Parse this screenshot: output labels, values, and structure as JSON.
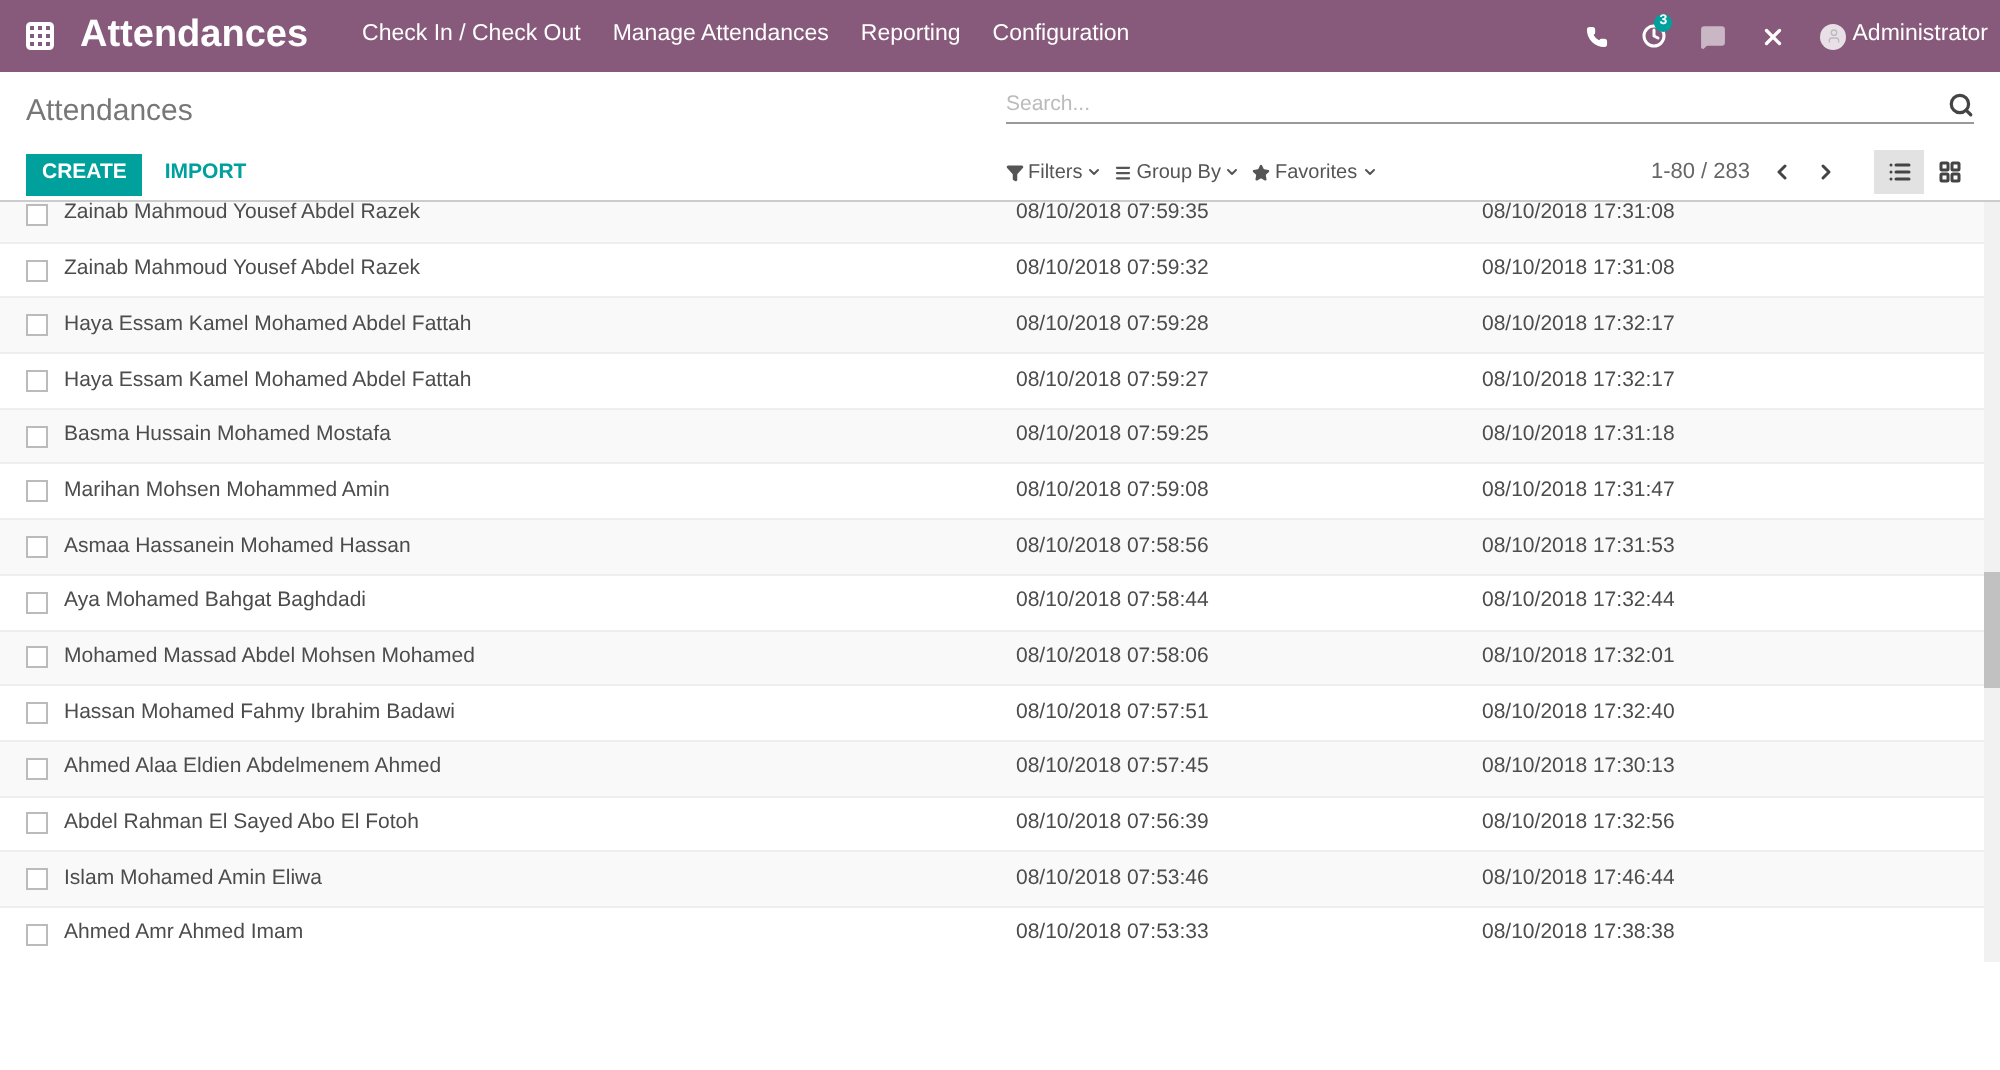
{
  "app_title": "Attendances",
  "menu": [
    "Check In / Check Out",
    "Manage Attendances",
    "Reporting",
    "Configuration"
  ],
  "systray": {
    "activity_count": "3",
    "user": "Administrator"
  },
  "breadcrumb": "Attendances",
  "search": {
    "placeholder": "Search..."
  },
  "buttons": {
    "create": "CREATE",
    "import": "IMPORT"
  },
  "search_options": [
    "Filters",
    "Group By",
    "Favorites"
  ],
  "pager": "1-80 / 283",
  "views": [
    {
      "kind": "list",
      "selected": true
    },
    {
      "kind": "kanban",
      "selected": false
    }
  ],
  "rows": [
    {
      "employee": "Zainab Mahmoud Yousef Abdel Razek",
      "check_in": "08/10/2018 07:59:35",
      "check_out": "08/10/2018 17:31:08",
      "checked": false
    },
    {
      "employee": "Zainab Mahmoud Yousef Abdel Razek",
      "check_in": "08/10/2018 07:59:32",
      "check_out": "08/10/2018 17:31:08",
      "checked": false
    },
    {
      "employee": "Haya Essam Kamel Mohamed Abdel Fattah",
      "check_in": "08/10/2018 07:59:28",
      "check_out": "08/10/2018 17:32:17",
      "checked": false
    },
    {
      "employee": "Haya Essam Kamel Mohamed Abdel Fattah",
      "check_in": "08/10/2018 07:59:27",
      "check_out": "08/10/2018 17:32:17",
      "checked": false
    },
    {
      "employee": "Basma Hussain Mohamed Mostafa",
      "check_in": "08/10/2018 07:59:25",
      "check_out": "08/10/2018 17:31:18",
      "checked": false
    },
    {
      "employee": "Marihan Mohsen Mohammed Amin",
      "check_in": "08/10/2018 07:59:08",
      "check_out": "08/10/2018 17:31:47",
      "checked": false
    },
    {
      "employee": "Asmaa Hassanein Mohamed Hassan",
      "check_in": "08/10/2018 07:58:56",
      "check_out": "08/10/2018 17:31:53",
      "checked": false
    },
    {
      "employee": "Aya Mohamed Bahgat Baghdadi",
      "check_in": "08/10/2018 07:58:44",
      "check_out": "08/10/2018 17:32:44",
      "checked": false
    },
    {
      "employee": "Mohamed Massad Abdel Mohsen Mohamed",
      "check_in": "08/10/2018 07:58:06",
      "check_out": "08/10/2018 17:32:01",
      "checked": false
    },
    {
      "employee": "Hassan Mohamed Fahmy Ibrahim Badawi",
      "check_in": "08/10/2018 07:57:51",
      "check_out": "08/10/2018 17:32:40",
      "checked": false
    },
    {
      "employee": "Ahmed Alaa Eldien Abdelmenem Ahmed",
      "check_in": "08/10/2018 07:57:45",
      "check_out": "08/10/2018 17:30:13",
      "checked": false
    },
    {
      "employee": "Abdel Rahman El Sayed Abo El Fotoh",
      "check_in": "08/10/2018 07:56:39",
      "check_out": "08/10/2018 17:32:56",
      "checked": false
    },
    {
      "employee": "Islam Mohamed Amin Eliwa",
      "check_in": "08/10/2018 07:53:46",
      "check_out": "08/10/2018 17:46:44",
      "checked": false
    },
    {
      "employee": "Ahmed Amr Ahmed Imam",
      "check_in": "08/10/2018 07:53:33",
      "check_out": "08/10/2018 17:38:38",
      "checked": false
    }
  ]
}
